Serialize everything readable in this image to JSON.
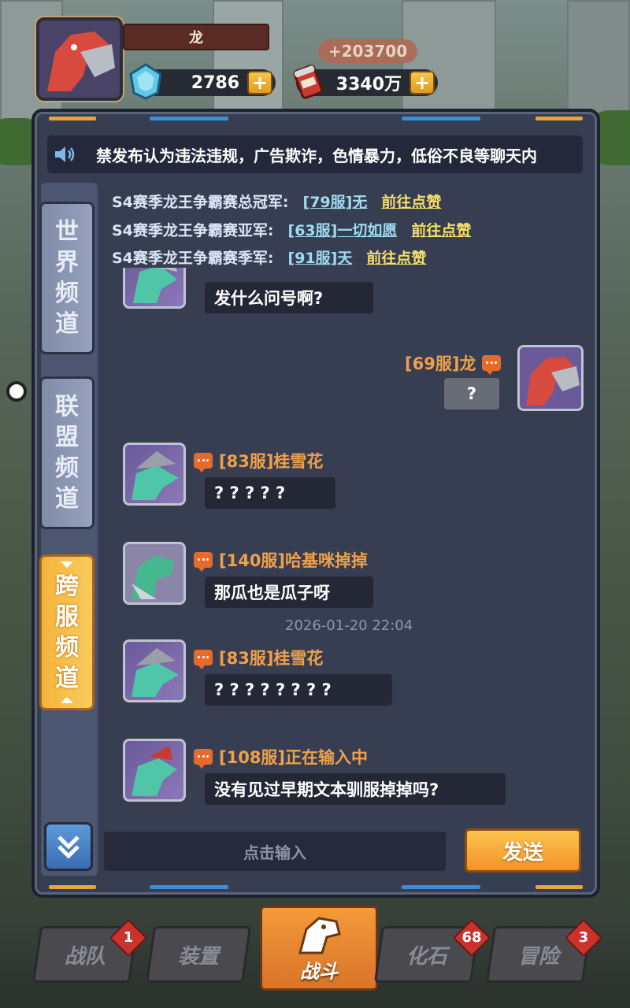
{
  "player": {
    "name": "龙",
    "gems": "2786",
    "cans": "3340万",
    "gain": "+203700"
  },
  "notice": {
    "text": "禁发布认为违法违规，广告欺诈，色情暴力，低俗不良等聊天内"
  },
  "tabs": [
    "世界频道",
    "联盟频道",
    "跨服频道"
  ],
  "tab_chars": {
    "world": [
      "世",
      "界",
      "频",
      "道"
    ],
    "alliance": [
      "联",
      "盟",
      "频",
      "道"
    ],
    "cross": [
      "跨",
      "服",
      "频",
      "道"
    ]
  },
  "active_tab": "跨服频道",
  "champions": [
    {
      "label": "S4赛季龙王争霸赛总冠军:",
      "server": "[79服]无",
      "action": "前往点赞"
    },
    {
      "label": "S4赛季龙王争霸赛亚军:",
      "server": "[63服]一切如愿",
      "action": "前往点赞"
    },
    {
      "label": "S4赛季龙王争霸赛季军:",
      "server": "[91服]天",
      "action": "前往点赞"
    }
  ],
  "messages": [
    {
      "name": "",
      "text": "发什么问号啊?"
    },
    {
      "name": "[69服]龙",
      "text": "?",
      "mine": true
    },
    {
      "name": "[83服]桂雪花",
      "text": "? ? ? ? ?"
    },
    {
      "name": "[140服]哈基咪掉掉",
      "text": "那瓜也是瓜子呀"
    },
    {
      "timestamp": "2026-01-20 22:04"
    },
    {
      "name": "[83服]桂雪花",
      "text": "? ? ? ? ? ? ? ?"
    },
    {
      "name": "[108服]正在输入中",
      "text": "没有见过早期文本驯服掉掉吗?"
    }
  ],
  "input": {
    "placeholder": "点击输入"
  },
  "send_label": "发送",
  "nav": [
    {
      "label": "战队",
      "badge": "1"
    },
    {
      "label": "装置",
      "badge": ""
    },
    {
      "label": "战斗",
      "badge": ""
    },
    {
      "label": "化石",
      "badge": "68"
    },
    {
      "label": "冒险",
      "badge": "3"
    }
  ],
  "colors": {
    "accent": "#f5b43b",
    "panel": "#373e52",
    "name": "#f0a04a",
    "link": "#f4dd6a"
  }
}
